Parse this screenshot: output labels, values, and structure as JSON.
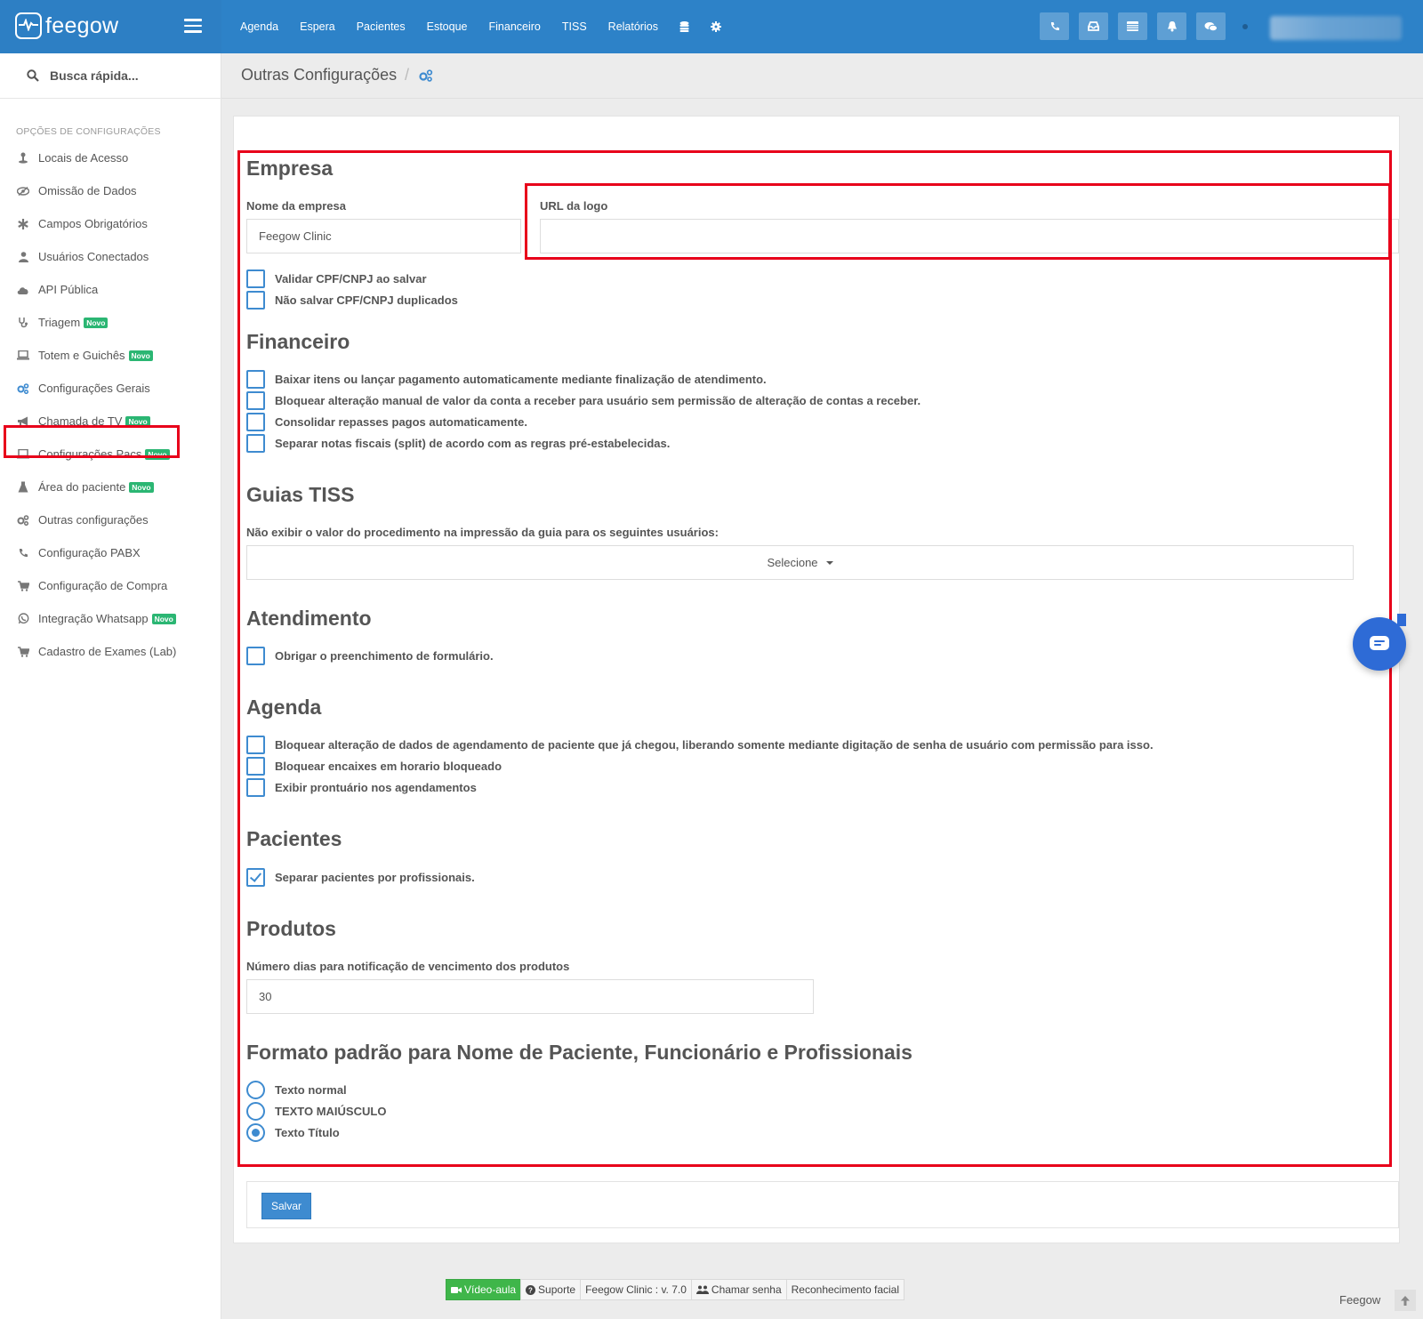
{
  "app": {
    "logo_text": "feegow"
  },
  "nav": {
    "items": [
      "Agenda",
      "Espera",
      "Pacientes",
      "Estoque",
      "Financeiro",
      "TISS",
      "Relatórios"
    ],
    "icon_items": [
      "database-icon",
      "gear-icon"
    ]
  },
  "top_actions": [
    "phone-icon",
    "inbox-icon",
    "list-icon",
    "bell-icon",
    "chat-icon"
  ],
  "sidebar": {
    "search_placeholder": "Busca rápida...",
    "heading": "OPÇÕES DE CONFIGURAÇÕES",
    "items": [
      {
        "label": "Locais de Acesso",
        "icon": "location-icon",
        "badge": ""
      },
      {
        "label": "Omissão de Dados",
        "icon": "eye-slash-icon",
        "badge": ""
      },
      {
        "label": "Campos Obrigatórios",
        "icon": "asterisk-icon",
        "badge": ""
      },
      {
        "label": "Usuários Conectados",
        "icon": "user-icon",
        "badge": ""
      },
      {
        "label": "API Pública",
        "icon": "cloud-icon",
        "badge": ""
      },
      {
        "label": "Triagem",
        "icon": "stethoscope-icon",
        "badge": "Novo"
      },
      {
        "label": "Totem e Guichês",
        "icon": "laptop-icon",
        "badge": "Novo"
      },
      {
        "label": "Configurações Gerais",
        "icon": "cogs-icon",
        "badge": ""
      },
      {
        "label": "Chamada de TV",
        "icon": "megaphone-icon",
        "badge": "Novo"
      },
      {
        "label": "Configurações Pacs",
        "icon": "laptop-icon",
        "badge": "Novo"
      },
      {
        "label": "Área do paciente",
        "icon": "flask-icon",
        "badge": "Novo"
      },
      {
        "label": "Outras configurações",
        "icon": "cogs-icon",
        "badge": ""
      },
      {
        "label": "Configuração PABX",
        "icon": "phone-icon",
        "badge": ""
      },
      {
        "label": "Configuração de Compra",
        "icon": "cart-icon",
        "badge": ""
      },
      {
        "label": "Integração Whatsapp",
        "icon": "whatsapp-icon",
        "badge": "Novo"
      },
      {
        "label": "Cadastro de Exames (Lab)",
        "icon": "cart-icon",
        "badge": ""
      }
    ]
  },
  "breadcrumb": {
    "title": "Outras Configurações",
    "separator": "/"
  },
  "empresa": {
    "title": "Empresa",
    "nome_label": "Nome da empresa",
    "nome_value": "Feegow Clinic",
    "url_label": "URL da logo",
    "url_value": "",
    "checks": [
      {
        "label": "Validar CPF/CNPJ ao salvar",
        "checked": false
      },
      {
        "label": "Não salvar CPF/CNPJ duplicados",
        "checked": false
      }
    ]
  },
  "financeiro": {
    "title": "Financeiro",
    "checks": [
      {
        "label": "Baixar itens ou lançar pagamento automaticamente mediante finalização de atendimento.",
        "checked": false
      },
      {
        "label": "Bloquear alteração manual de valor da conta a receber para usuário sem permissão de alteração de contas a receber.",
        "checked": false
      },
      {
        "label": "Consolidar repasses pagos automaticamente.",
        "checked": false
      },
      {
        "label": "Separar notas fiscais (split) de acordo com as regras pré-estabelecidas.",
        "checked": false
      }
    ]
  },
  "tiss": {
    "title": "Guias TISS",
    "label": "Não exibir o valor do procedimento na impressão da guia para os seguintes usuários:",
    "select_value": "Selecione"
  },
  "atendimento": {
    "title": "Atendimento",
    "checks": [
      {
        "label": "Obrigar o preenchimento de formulário.",
        "checked": false
      }
    ]
  },
  "agenda": {
    "title": "Agenda",
    "checks": [
      {
        "label": "Bloquear alteração de dados de agendamento de paciente que já chegou, liberando somente mediante digitação de senha de usuário com permissão para isso.",
        "checked": false
      },
      {
        "label": "Bloquear encaixes em horario bloqueado",
        "checked": false
      },
      {
        "label": "Exibir prontuário nos agendamentos",
        "checked": false
      }
    ]
  },
  "pacientes": {
    "title": "Pacientes",
    "checks": [
      {
        "label": "Separar pacientes por profissionais.",
        "checked": true
      }
    ]
  },
  "produtos": {
    "title": "Produtos",
    "label": "Número dias para notificação de vencimento dos produtos",
    "value": "30"
  },
  "formato": {
    "title": "Formato padrão para Nome de Paciente, Funcionário e Profissionais",
    "options": [
      {
        "label": "Texto normal",
        "checked": false
      },
      {
        "label": "TEXTO MAIÚSCULO",
        "checked": false
      },
      {
        "label": "Texto Título",
        "checked": true
      }
    ]
  },
  "actions": {
    "save_label": "Salvar"
  },
  "footer": {
    "video": "Vídeo-aula",
    "support": "Suporte",
    "version": "Feegow Clinic : v. 7.0",
    "call": "Chamar senha",
    "face": "Reconhecimento facial",
    "brand": "Feegow"
  },
  "colors": {
    "primary": "#2d82c8",
    "accent": "#3e8bd0",
    "highlight": "#e8001a",
    "badge": "#2bb673"
  }
}
